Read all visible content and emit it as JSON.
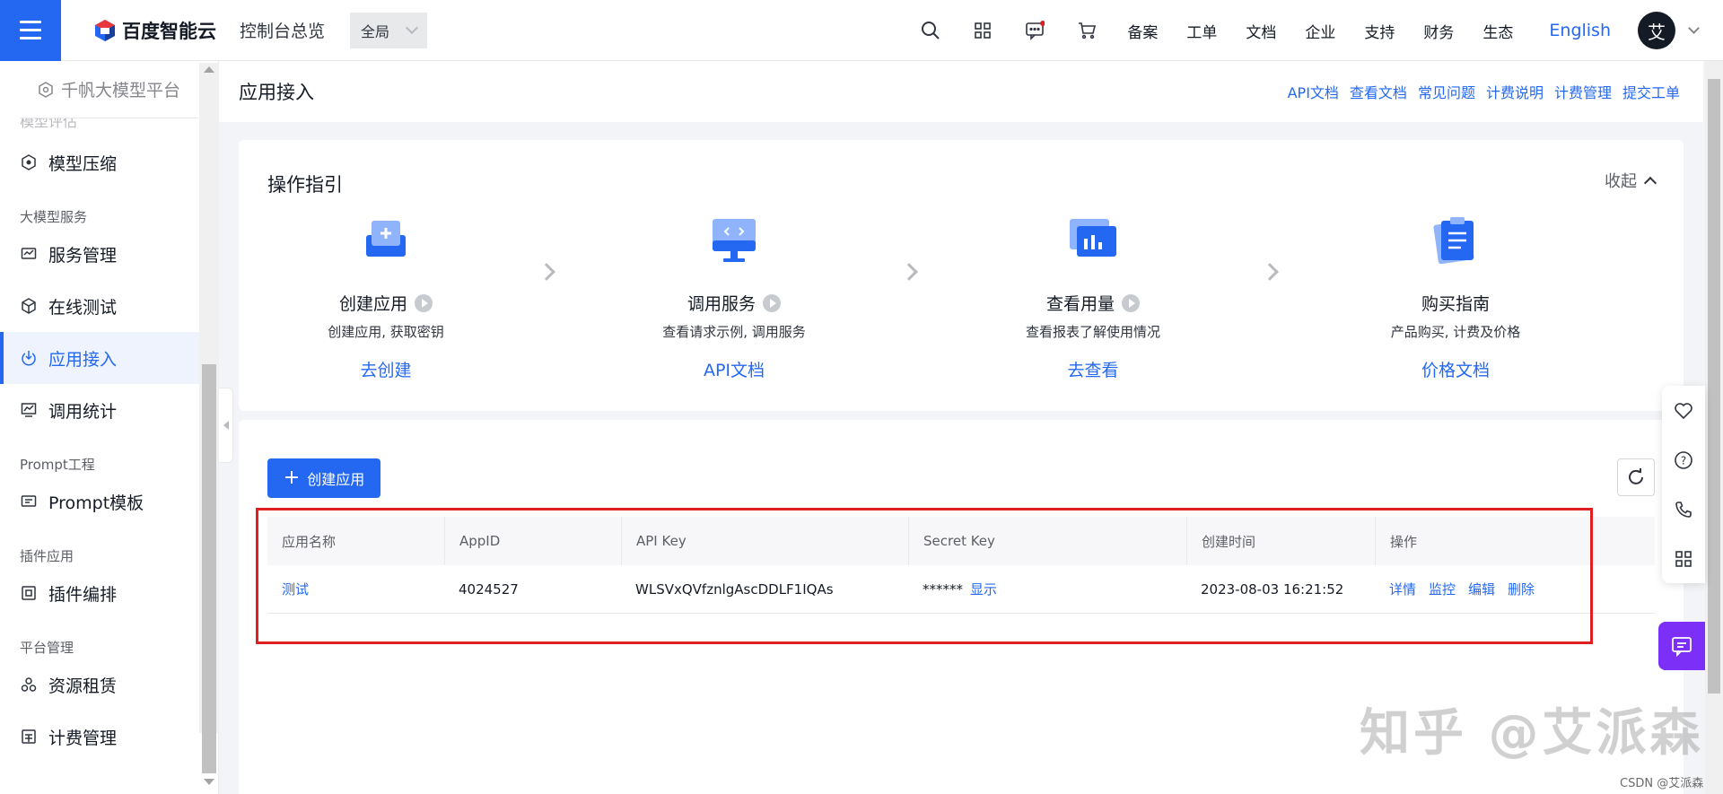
{
  "topbar": {
    "brand": "百度智能云",
    "console": "控制台总览",
    "scope": "全局",
    "nav": [
      "备案",
      "工单",
      "文档",
      "企业",
      "支持",
      "财务",
      "生态"
    ],
    "lang": "English",
    "avatar": "艾",
    "brand_color": "#2468f2"
  },
  "sidebar": {
    "platform": "千帆大模型平台",
    "cut_item": "模型评估",
    "items": [
      {
        "label": "模型压缩",
        "icon": "compress-icon"
      },
      {
        "group": "大模型服务"
      },
      {
        "label": "服务管理",
        "icon": "service-icon"
      },
      {
        "label": "在线测试",
        "icon": "test-icon"
      },
      {
        "label": "应用接入",
        "icon": "app-access-icon",
        "active": true
      },
      {
        "label": "调用统计",
        "icon": "stats-icon"
      },
      {
        "group": "Prompt工程"
      },
      {
        "label": "Prompt模板",
        "icon": "template-icon"
      },
      {
        "group": "插件应用"
      },
      {
        "label": "插件编排",
        "icon": "plugin-icon"
      },
      {
        "group": "平台管理"
      },
      {
        "label": "资源租赁",
        "icon": "resource-icon"
      },
      {
        "label": "计费管理",
        "icon": "billing-icon"
      }
    ]
  },
  "page": {
    "title": "应用接入",
    "doc_links": [
      "API文档",
      "查看文档",
      "常见问题",
      "计费说明",
      "计费管理",
      "提交工单"
    ]
  },
  "guide": {
    "title": "操作指引",
    "collapse": "收起",
    "steps": [
      {
        "name": "创建应用",
        "desc": "创建应用, 获取密钥",
        "link": "去创建",
        "has_play": true
      },
      {
        "name": "调用服务",
        "desc": "查看请求示例, 调用服务",
        "link": "API文档",
        "has_play": true
      },
      {
        "name": "查看用量",
        "desc": "查看报表了解使用情况",
        "link": "去查看",
        "has_play": true
      },
      {
        "name": "购买指南",
        "desc": "产品购买, 计费及价格",
        "link": "价格文档",
        "has_play": false
      }
    ]
  },
  "apps": {
    "create_label": "创建应用",
    "columns": [
      "应用名称",
      "AppID",
      "API Key",
      "Secret Key",
      "创建时间",
      "操作"
    ],
    "rows": [
      {
        "name": "测试",
        "app_id": "4024527",
        "api_key": "WLSVxQVfznlgAscDDLF1IQAs",
        "secret_mask": "******",
        "secret_show": "显示",
        "created": "2023-08-03 16:21:52",
        "ops": [
          "详情",
          "监控",
          "编辑",
          "删除"
        ]
      }
    ]
  },
  "watermark": "知乎 @艾派森",
  "credit": "CSDN @艾派森"
}
